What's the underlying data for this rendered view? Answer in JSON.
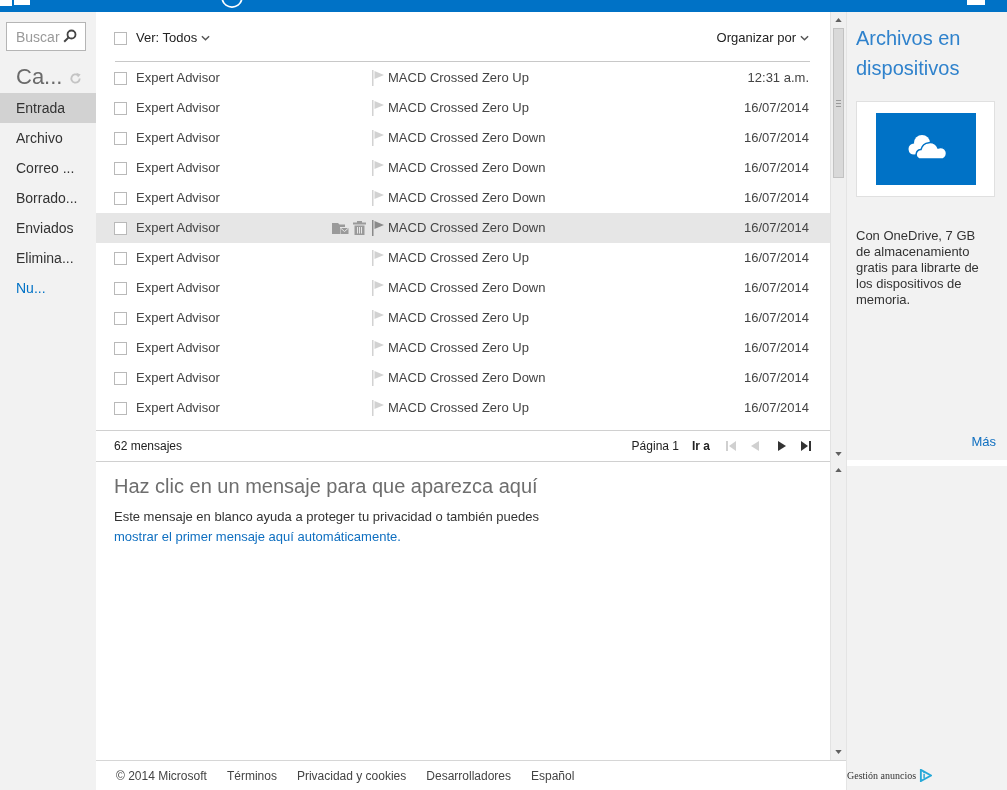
{
  "sidebar": {
    "search": {
      "placeholder": "Buscar"
    },
    "heading": "Ca...",
    "folders": [
      {
        "label": "Entrada",
        "selected": true
      },
      {
        "label": "Archivo",
        "selected": false
      },
      {
        "label": "Correo ...",
        "selected": false
      },
      {
        "label": "Borrado...",
        "selected": false
      },
      {
        "label": "Enviados",
        "selected": false
      },
      {
        "label": "Elimina...",
        "selected": false
      }
    ],
    "new_folder": "Nu..."
  },
  "message_list": {
    "select_all_checked": false,
    "filter": "Ver: Todos",
    "sort": "Organizar por",
    "messages": [
      {
        "sender": "Expert Advisor",
        "subject": "MACD Crossed Zero Up",
        "date": "12:31 a.m.",
        "checked": false,
        "hovered": false
      },
      {
        "sender": "Expert Advisor",
        "subject": "MACD Crossed Zero Up",
        "date": "16/07/2014",
        "checked": false,
        "hovered": false
      },
      {
        "sender": "Expert Advisor",
        "subject": "MACD Crossed Zero Down",
        "date": "16/07/2014",
        "checked": false,
        "hovered": false
      },
      {
        "sender": "Expert Advisor",
        "subject": "MACD Crossed Zero Down",
        "date": "16/07/2014",
        "checked": false,
        "hovered": false
      },
      {
        "sender": "Expert Advisor",
        "subject": "MACD Crossed Zero Down",
        "date": "16/07/2014",
        "checked": false,
        "hovered": false
      },
      {
        "sender": "Expert Advisor",
        "subject": "MACD Crossed Zero Down",
        "date": "16/07/2014",
        "checked": false,
        "hovered": true
      },
      {
        "sender": "Expert Advisor",
        "subject": "MACD Crossed Zero Up",
        "date": "16/07/2014",
        "checked": false,
        "hovered": false
      },
      {
        "sender": "Expert Advisor",
        "subject": "MACD Crossed Zero Down",
        "date": "16/07/2014",
        "checked": false,
        "hovered": false
      },
      {
        "sender": "Expert Advisor",
        "subject": "MACD Crossed Zero Up",
        "date": "16/07/2014",
        "checked": false,
        "hovered": false
      },
      {
        "sender": "Expert Advisor",
        "subject": "MACD Crossed Zero Up",
        "date": "16/07/2014",
        "checked": false,
        "hovered": false
      },
      {
        "sender": "Expert Advisor",
        "subject": "MACD Crossed Zero Down",
        "date": "16/07/2014",
        "checked": false,
        "hovered": false
      },
      {
        "sender": "Expert Advisor",
        "subject": "MACD Crossed Zero Up",
        "date": "16/07/2014",
        "checked": false,
        "hovered": false
      }
    ],
    "count": "62 mensajes",
    "page": "Página 1",
    "goto": "Ir a",
    "pager": [
      {
        "kind": "first",
        "disabled": true
      },
      {
        "kind": "previous",
        "disabled": true
      },
      {
        "kind": "next",
        "disabled": false
      },
      {
        "kind": "last",
        "disabled": false
      }
    ]
  },
  "reading_pane": {
    "title": "Haz clic en un mensaje para que aparezca aquí",
    "text": "Este mensaje en blanco ayuda a proteger tu privacidad o también puedes",
    "link": "mostrar el primer mensaje aquí automáticamente."
  },
  "promo": {
    "title": "Archivos en dispositivos",
    "text": "Con OneDrive, 7 GB de almacenamiento gratis para librarte de los dispositivos de memoria.",
    "more_link": "Más"
  },
  "footer": {
    "copyright": "© 2014 Microsoft",
    "links": [
      "Términos",
      "Privacidad y cookies",
      "Desarrolladores",
      "Español"
    ],
    "ads": "Gestión anuncios"
  }
}
